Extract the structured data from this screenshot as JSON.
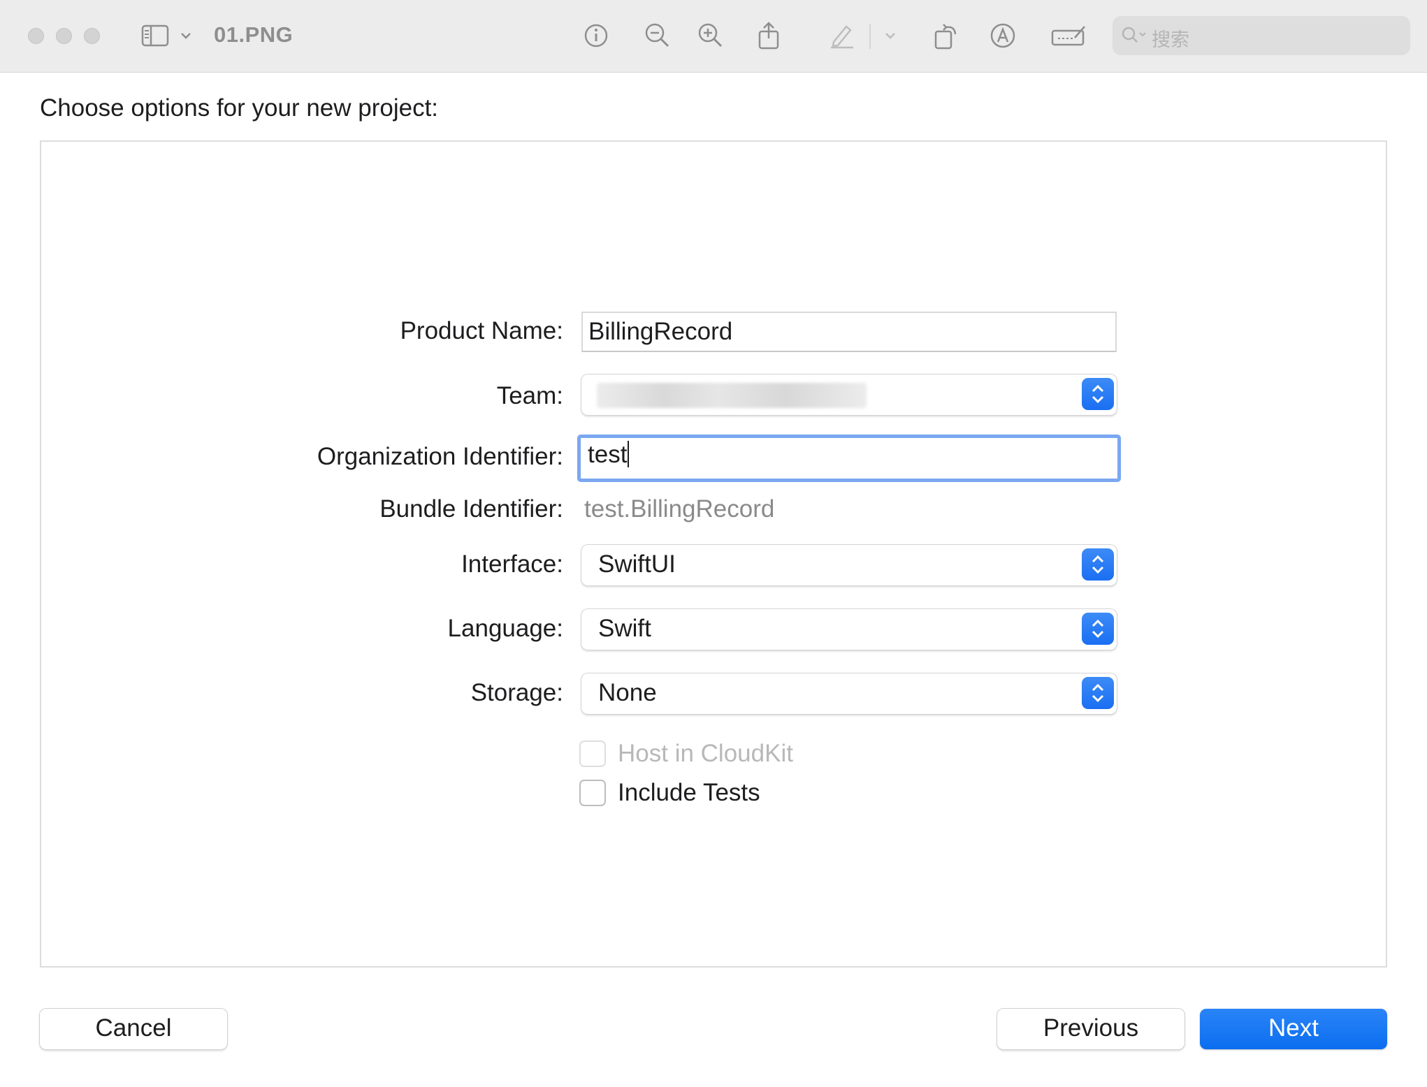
{
  "window": {
    "document_title": "01.PNG",
    "search": {
      "placeholder": "搜索"
    },
    "toolbar": {
      "icons": [
        "sidebar-toggle-icon",
        "chevron-down-icon",
        "info-icon",
        "zoom-out-icon",
        "zoom-in-icon",
        "share-icon",
        "markup-pencil-icon",
        "chevron-down-icon",
        "rotate-icon",
        "annotate-icon",
        "signature-icon",
        "search-icon"
      ]
    }
  },
  "dialog": {
    "heading": "Choose options for your new project:",
    "fields": {
      "product_name": {
        "label": "Product Name:",
        "value": "BillingRecord"
      },
      "team": {
        "label": "Team:",
        "value": ""
      },
      "organization_identifier": {
        "label": "Organization Identifier:",
        "value": "test"
      },
      "bundle_identifier": {
        "label": "Bundle Identifier:",
        "value": "test.BillingRecord"
      },
      "interface": {
        "label": "Interface:",
        "value": "SwiftUI"
      },
      "language": {
        "label": "Language:",
        "value": "Swift"
      },
      "storage": {
        "label": "Storage:",
        "value": "None"
      }
    },
    "checkboxes": {
      "host_in_cloudkit": {
        "label": "Host in CloudKit",
        "checked": false,
        "enabled": false
      },
      "include_tests": {
        "label": "Include Tests",
        "checked": false,
        "enabled": true
      }
    },
    "buttons": {
      "cancel": "Cancel",
      "previous": "Previous",
      "next": "Next"
    }
  },
  "colors": {
    "accent": "#1a6ff2",
    "focus_ring": "#7aa7f0",
    "titlebar": "#ececec"
  }
}
